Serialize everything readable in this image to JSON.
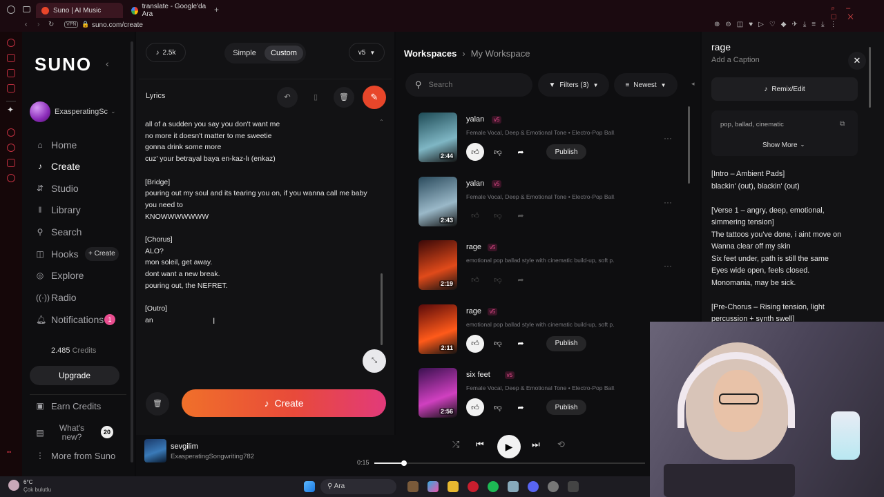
{
  "browser": {
    "tabs": [
      {
        "label": "Suno | AI Music"
      },
      {
        "label": "translate - Google'da Ara"
      }
    ],
    "vpn": "VPN",
    "url": "suno.com/create"
  },
  "sidebar": {
    "logo": "SUNO",
    "username": "ExasperatingSc",
    "items": [
      {
        "label": "Home",
        "icon": "home-icon"
      },
      {
        "label": "Create",
        "icon": "create-icon"
      },
      {
        "label": "Studio",
        "icon": "studio-icon"
      },
      {
        "label": "Library",
        "icon": "library-icon"
      },
      {
        "label": "Search",
        "icon": "search-icon"
      },
      {
        "label": "Hooks",
        "icon": "hooks-icon"
      },
      {
        "label": "Explore",
        "icon": "explore-icon"
      },
      {
        "label": "Radio",
        "icon": "radio-icon"
      },
      {
        "label": "Notifications",
        "icon": "bell-icon"
      }
    ],
    "hooks_create": "+ Create",
    "notifications_count": "1",
    "credits_value": "2.485",
    "credits_label": "Credits",
    "upgrade": "Upgrade",
    "earn_credits": "Earn Credits",
    "whats_new": "What's new?",
    "whats_new_count": "20",
    "more_from_suno": "More from Suno"
  },
  "create": {
    "credits": "2.5k",
    "mode_simple": "Simple",
    "mode_custom": "Custom",
    "version": "v5",
    "lyrics_label": "Lyrics",
    "lyrics": "all of a sudden you say you don't want me\nno more it doesn't matter to me sweetie\ngonna drink some more\ncuz' your betrayal baya en-kaz-lı (enkaz)\n\n[Bridge]\npouring out my soul and its tearing you on, if you wanna call me baby\nyou need to\nKNOWWWWWWW\n\n[Chorus]\nALO?\nmon soleil, get away.\ndont want a new break.\npouring out, the NEFRET.\n\n[Outro]\nan",
    "create_button": "Create"
  },
  "workspace": {
    "breadcrumb_root": "Workspaces",
    "breadcrumb_current": "My Workspace",
    "search_placeholder": "Search",
    "filters": "Filters (3)",
    "sort": "Newest",
    "publish_label": "Publish",
    "songs": [
      {
        "title": "yalan",
        "version": "v5",
        "desc": "Female Vocal, Deep & Emotional Tone • Electro-Pop Ball...",
        "duration": "2:44",
        "colors": [
          "#1d4a55",
          "#7fb6c4"
        ],
        "published_controls": true
      },
      {
        "title": "yalan",
        "version": "v5",
        "desc": "Female Vocal, Deep & Emotional Tone • Electro-Pop Ball...",
        "duration": "2:43",
        "colors": [
          "#2a4a5c",
          "#9ab8c8"
        ],
        "published_controls": false
      },
      {
        "title": "rage",
        "version": "v5",
        "desc": "emotional pop ballad style with cinematic build-up, soft p...",
        "duration": "2:19",
        "colors": [
          "#3a0808",
          "#e04a1a"
        ],
        "published_controls": false
      },
      {
        "title": "rage",
        "version": "v5",
        "desc": "emotional pop ballad style with cinematic build-up, soft p...",
        "duration": "2:11",
        "colors": [
          "#5a0a0a",
          "#ff5a1a"
        ],
        "published_controls": true
      },
      {
        "title": "six feet",
        "version": "v5",
        "desc": "Female Vocal, Deep & Emotional Tone • Electro-Pop Ball...",
        "duration": "2:56",
        "colors": [
          "#3a1050",
          "#d040c0"
        ],
        "published_controls": true
      }
    ]
  },
  "detail": {
    "title": "rage",
    "caption_placeholder": "Add a Caption",
    "remix": "Remix/Edit",
    "tags": "pop, ballad, cinematic",
    "show_more": "Show More",
    "lyrics": "[Intro – Ambient Pads]\nblackin' (out), blackin' (out)\n\n[Verse 1 – angry, deep, emotional,\nsimmering tension]\nThe tattoos you've done, i aint move on\nWanna clear off my skin\nSix feet under, path is still the same\nEyes wide open, feels closed.\nMonomania, may be sick.\n\n[Pre-Chorus – Rising tension, light\npercussion + synth swell]"
  },
  "player": {
    "title": "sevgilim",
    "artist": "ExasperatingSongwriting782",
    "time": "0:15",
    "progress": 0.11
  },
  "taskbar": {
    "temp": "6°C",
    "weather": "Çok bulutlu",
    "search": "Ara"
  },
  "colors": {
    "accent": "#e8462a",
    "pink": "#e94d8f"
  }
}
